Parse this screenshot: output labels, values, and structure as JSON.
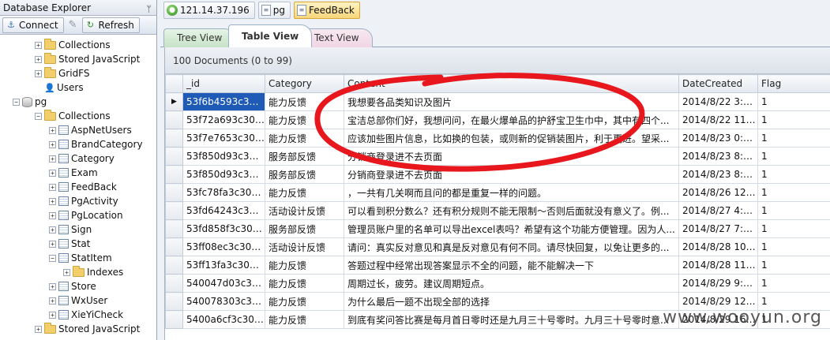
{
  "explorer": {
    "title": "Database Explorer",
    "connect_label": "Connect",
    "refresh_label": "Refresh",
    "tree": [
      {
        "label": "Collections",
        "icon": "folder-icon",
        "indent": 1
      },
      {
        "label": "Stored JavaScript",
        "icon": "folder-icon",
        "indent": 1
      },
      {
        "label": "GridFS",
        "icon": "folder-icon",
        "indent": 1
      },
      {
        "label": "Users",
        "icon": "user-icon",
        "indent": 1
      },
      {
        "label": "pg",
        "icon": "db-icon",
        "indent": 0
      },
      {
        "label": "Collections",
        "icon": "folder-icon",
        "indent": 1
      },
      {
        "label": "AspNetUsers",
        "icon": "table-icon",
        "indent": 2
      },
      {
        "label": "BrandCategory",
        "icon": "table-icon",
        "indent": 2
      },
      {
        "label": "Category",
        "icon": "table-icon",
        "indent": 2
      },
      {
        "label": "Exam",
        "icon": "table-icon",
        "indent": 2
      },
      {
        "label": "FeedBack",
        "icon": "table-icon",
        "indent": 2
      },
      {
        "label": "PgActivity",
        "icon": "table-icon",
        "indent": 2
      },
      {
        "label": "PgLocation",
        "icon": "table-icon",
        "indent": 2
      },
      {
        "label": "Sign",
        "icon": "table-icon",
        "indent": 2
      },
      {
        "label": "Stat",
        "icon": "table-icon",
        "indent": 2
      },
      {
        "label": "StatItem",
        "icon": "table-icon",
        "indent": 2
      },
      {
        "label": "Indexes",
        "icon": "folder-icon",
        "indent": 3
      },
      {
        "label": "Store",
        "icon": "table-icon",
        "indent": 2
      },
      {
        "label": "WxUser",
        "icon": "table-icon",
        "indent": 2
      },
      {
        "label": "XieYiCheck",
        "icon": "table-icon",
        "indent": 2
      },
      {
        "label": "Stored JavaScript",
        "icon": "folder-icon",
        "indent": 1
      }
    ]
  },
  "tabs": {
    "server": "121.14.37.196",
    "database": "pg",
    "collection": "FeedBack"
  },
  "views": {
    "tree": "Tree View",
    "table": "Table View",
    "text": "Text View"
  },
  "grid": {
    "doc_count": "100 Documents (0 to 99)",
    "columns": [
      "_id",
      "Category",
      "Content",
      "DateCreated",
      "Flag"
    ],
    "rows": [
      [
        "53f6b4593c306...",
        "能力反馈",
        "我想要各品类知识及图片",
        "2014/8/22 3:09:...",
        "1"
      ],
      [
        "53f72a693c306...",
        "能力反馈",
        "宝洁总部你们好，我想问问，在最火爆单品的护舒宝卫生巾中，其中有四个...",
        "2014/8/22 11:3...",
        "1"
      ],
      [
        "53f7e7653c306...",
        "能力反馈",
        "应该加些图片信息，比如换的包装，或则新的促销装图片，利于更进。望采...",
        "2014/8/23 0:59:...",
        "1"
      ],
      [
        "53f850d93c306...",
        "服务部反馈",
        "分销商登录进不去页面",
        "2014/8/23 8:29:...",
        "1"
      ],
      [
        "53f850d93c306...",
        "服务部反馈",
        "分销商登录进不去页面",
        "2014/8/23 8:29:...",
        "1"
      ],
      [
        "53fc78fa3c306...",
        "能力反馈",
        "，一共有几关啊而且问的都是重复一样的问题。",
        "2014/8/26 12:0...",
        "1"
      ],
      [
        "53fd64243c306...",
        "活动设计反馈",
        "可以看到积分数么？还有积分规则不能无限制～否则后面就没有意义了。例...",
        "2014/8/27 4:52:...",
        "1"
      ],
      [
        "53fd858f3c306...",
        "服务部反馈",
        "管理员账户里的名单可以导出excel表吗？希望有这个功能方便管理。因为人...",
        "2014/8/27 7:15:...",
        "1"
      ],
      [
        "53ff08ec3c306...",
        "活动设计反馈",
        "请问：真实反对意见和真是反对意见有何不同。请尽快回复，以免让更多的...",
        "2014/8/28 10:3...",
        "1"
      ],
      [
        "53ff13fa3c3069...",
        "能力反馈",
        "答题过程中经常出现答案显示不全的问题，能不能解决一下",
        "2014/8/28 11:3...",
        "1"
      ],
      [
        "540047d03c306...",
        "能力反馈",
        "周期过长，疲劳。建议周期短点。",
        "2014/8/29 9:28:...",
        "1"
      ],
      [
        "540078303c306...",
        "能力反馈",
        "为什么最后一题不出现全部的选择",
        "2014/8/29 12:5...",
        "1"
      ],
      [
        "5400a6cf3c306...",
        "能力反馈",
        "到底有奖问答比赛是每月首日零时还是九月三十号零时。九月三十号零时意...",
        "2014/8/29 16:1...",
        "1"
      ]
    ]
  },
  "watermark": "www.wooyun.org",
  "colors": {
    "selection": "#1e5ab6",
    "annotation": "#e8171d",
    "active_tab": "#f7d67a"
  }
}
